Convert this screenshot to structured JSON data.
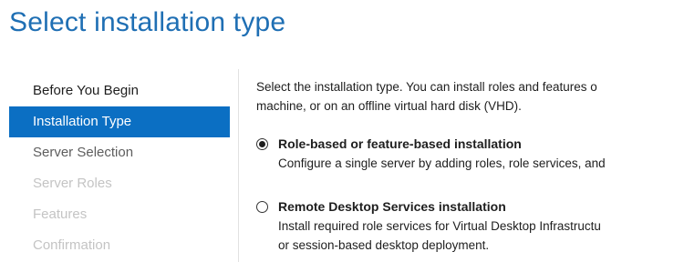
{
  "page": {
    "title": "Select installation type"
  },
  "nav": {
    "items": [
      {
        "label": "Before You Begin",
        "state": "normal"
      },
      {
        "label": "Installation Type",
        "state": "active"
      },
      {
        "label": "Server Selection",
        "state": "muted"
      },
      {
        "label": "Server Roles",
        "state": "disabled"
      },
      {
        "label": "Features",
        "state": "disabled"
      },
      {
        "label": "Confirmation",
        "state": "disabled"
      }
    ]
  },
  "content": {
    "intro_line1": "Select the installation type. You can install roles and features o",
    "intro_line2": "machine, or on an offline virtual hard disk (VHD).",
    "options": [
      {
        "label": "Role-based or feature-based installation",
        "selected": true,
        "desc_line1": "Configure a single server by adding roles, role services, and",
        "desc_line2": ""
      },
      {
        "label": "Remote Desktop Services installation",
        "selected": false,
        "desc_line1": "Install required role services for Virtual Desktop Infrastructu",
        "desc_line2": "or session-based desktop deployment."
      }
    ]
  },
  "colors": {
    "title": "#1f6fb4",
    "active_nav_bg": "#0b6fc3",
    "active_nav_text": "#ffffff",
    "disabled_nav_text": "#c4c4c4"
  }
}
